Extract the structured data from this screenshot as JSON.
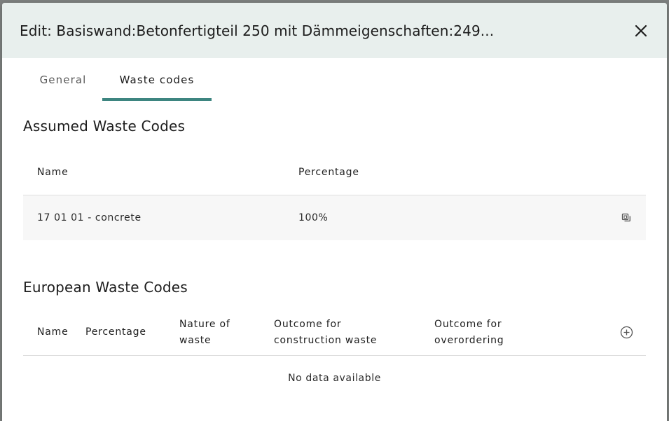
{
  "dialog": {
    "title": "Edit: Basiswand:Betonfertigteil 250 mit Dämmeigenschaften:249..."
  },
  "tabs": [
    {
      "label": "General"
    },
    {
      "label": "Waste codes"
    }
  ],
  "assumed": {
    "title": "Assumed Waste Codes",
    "columns": {
      "name": "Name",
      "percentage": "Percentage"
    },
    "rows": [
      {
        "name": "17 01 01 - concrete",
        "percentage": "100%"
      }
    ]
  },
  "european": {
    "title": "European Waste Codes",
    "columns": {
      "name": "Name",
      "percentage": "Percentage",
      "nature": "Nature of waste",
      "construction": "Outcome for construction waste",
      "overordering": "Outcome for overordering"
    },
    "empty_text": "No data available"
  },
  "colors": {
    "accent": "#3d8580",
    "header_bg": "#e8efed"
  },
  "icons": {
    "close": "close-icon",
    "copy": "copy-icon",
    "add": "add-circle-icon"
  }
}
